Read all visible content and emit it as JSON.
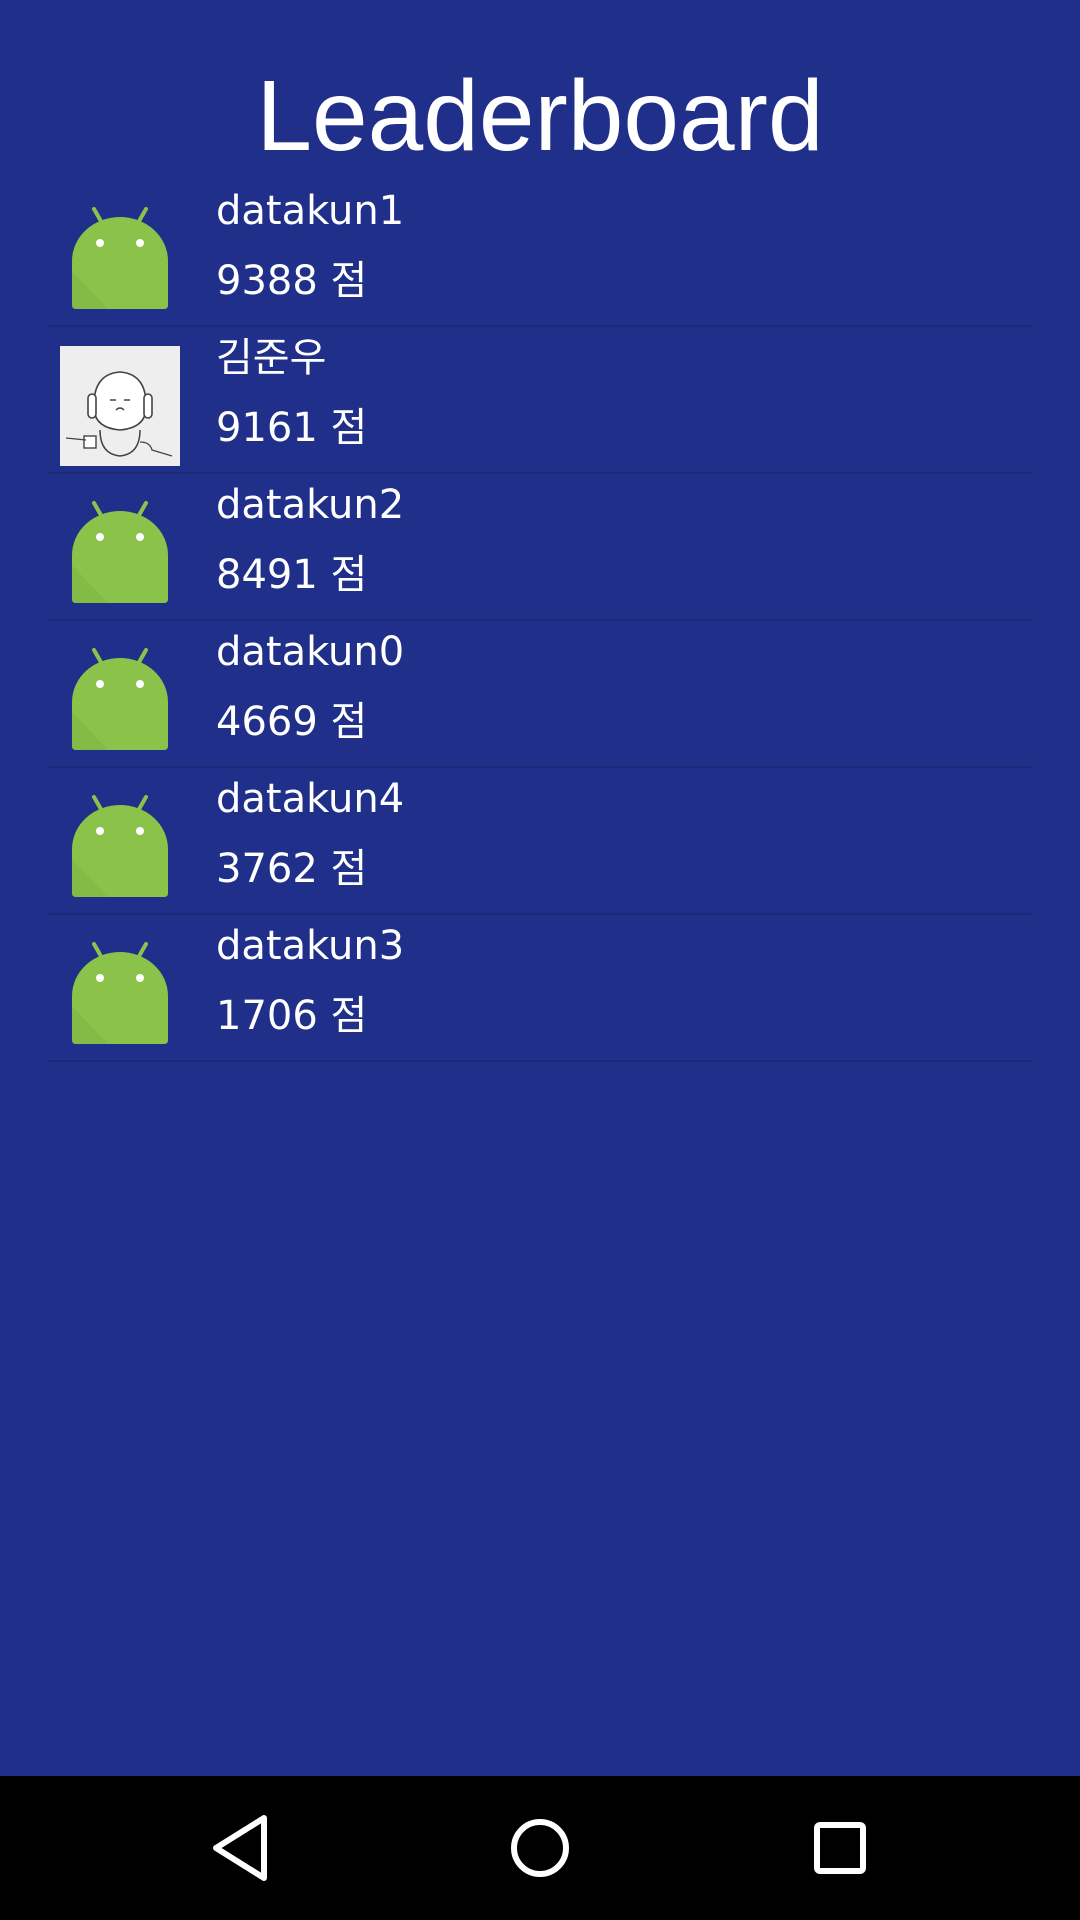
{
  "title": "Leaderboard",
  "score_suffix": "점",
  "entries": [
    {
      "name": "datakun1",
      "score": "9388 점",
      "avatar": "android-robot-icon"
    },
    {
      "name": "김준우",
      "score": "9161 점",
      "avatar": "profile-sketch-photo"
    },
    {
      "name": "datakun2",
      "score": "8491 점",
      "avatar": "android-robot-icon"
    },
    {
      "name": "datakun0",
      "score": "4669 점",
      "avatar": "android-robot-icon"
    },
    {
      "name": "datakun4",
      "score": "3762 점",
      "avatar": "android-robot-icon"
    },
    {
      "name": "datakun3",
      "score": "1706 점",
      "avatar": "android-robot-icon"
    }
  ],
  "navbar": {
    "back": "back-triangle-icon",
    "home": "home-circle-icon",
    "recents": "recents-square-icon"
  },
  "colors": {
    "background": "#1f2f8a",
    "android_green": "#8bc34a",
    "text": "#ffffff",
    "navbar": "#000000"
  }
}
